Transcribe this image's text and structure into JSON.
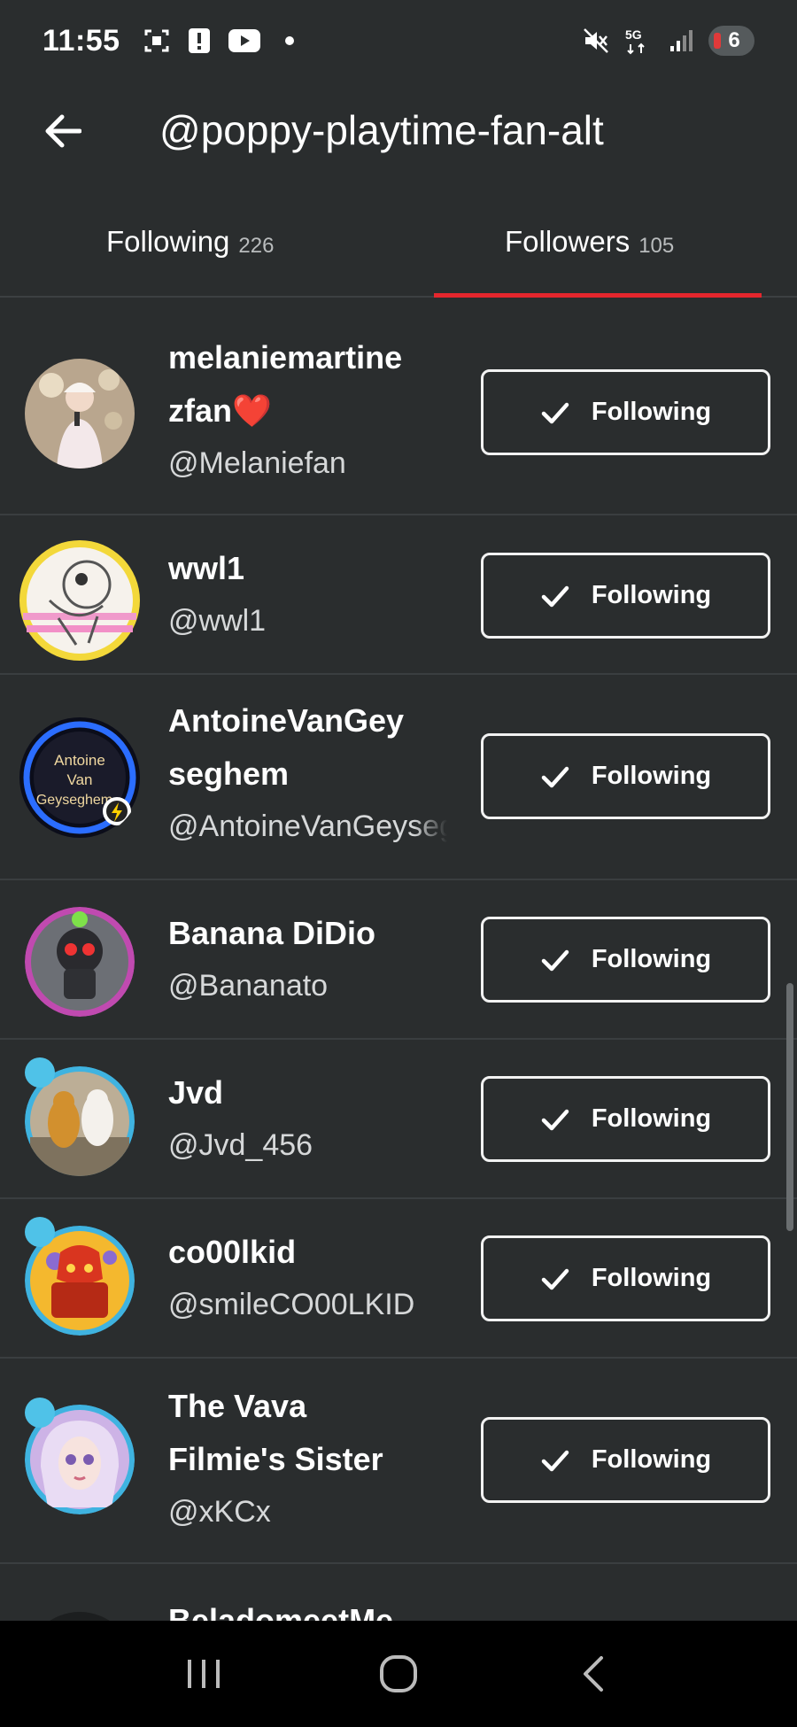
{
  "status_bar": {
    "time": "11:55",
    "left_icons": [
      "screenshot-icon",
      "alert-icon",
      "youtube-icon",
      "dot-icon"
    ],
    "right_icons": [
      "mute-icon",
      "5g-icon",
      "signal-icon"
    ],
    "network": "5G",
    "battery_label": "6"
  },
  "header": {
    "title": "@poppy-playtime-fan-alt",
    "back_icon": "arrow-left-icon"
  },
  "tabs": [
    {
      "label": "Following",
      "count": "226",
      "active": false
    },
    {
      "label": "Followers",
      "count": "105",
      "active": true
    }
  ],
  "accent_color": "#e4262d",
  "followers": [
    {
      "name_line1": "melaniemartine",
      "name_line2": "zfan❤️",
      "username": "@Melaniefan",
      "button_label": "Following",
      "button_icon": "checkmark-icon"
    },
    {
      "name_line1": "wwl1",
      "name_line2": "",
      "username": "@wwl1",
      "button_label": "Following",
      "button_icon": "checkmark-icon"
    },
    {
      "name_line1": "AntoineVanGey",
      "name_line2": "seghem",
      "username": "@AntoineVanGeyseghem",
      "button_label": "Following",
      "button_icon": "checkmark-icon",
      "avatar_text": [
        "Antoine",
        "Van",
        "Geyseghem"
      ]
    },
    {
      "name_line1": "Banana DiDio",
      "name_line2": "",
      "username": "@Bananato",
      "button_label": "Following",
      "button_icon": "checkmark-icon"
    },
    {
      "name_line1": "Jvd",
      "name_line2": "",
      "username": "@Jvd_456",
      "button_label": "Following",
      "button_icon": "checkmark-icon"
    },
    {
      "name_line1": "co00lkid",
      "name_line2": "",
      "username": "@smileCO00LKID",
      "button_label": "Following",
      "button_icon": "checkmark-icon"
    },
    {
      "name_line1": "The Vava",
      "name_line2": "Filmie's Sister",
      "username": "@xKCx",
      "button_label": "Following",
      "button_icon": "checkmark-icon"
    },
    {
      "name_line1": "BeladomeetMe",
      "name_line2": "",
      "username": "",
      "button_label": "",
      "button_icon": ""
    }
  ],
  "nav_bar": {
    "icons": [
      "recents-icon",
      "home-icon",
      "back-icon"
    ]
  }
}
